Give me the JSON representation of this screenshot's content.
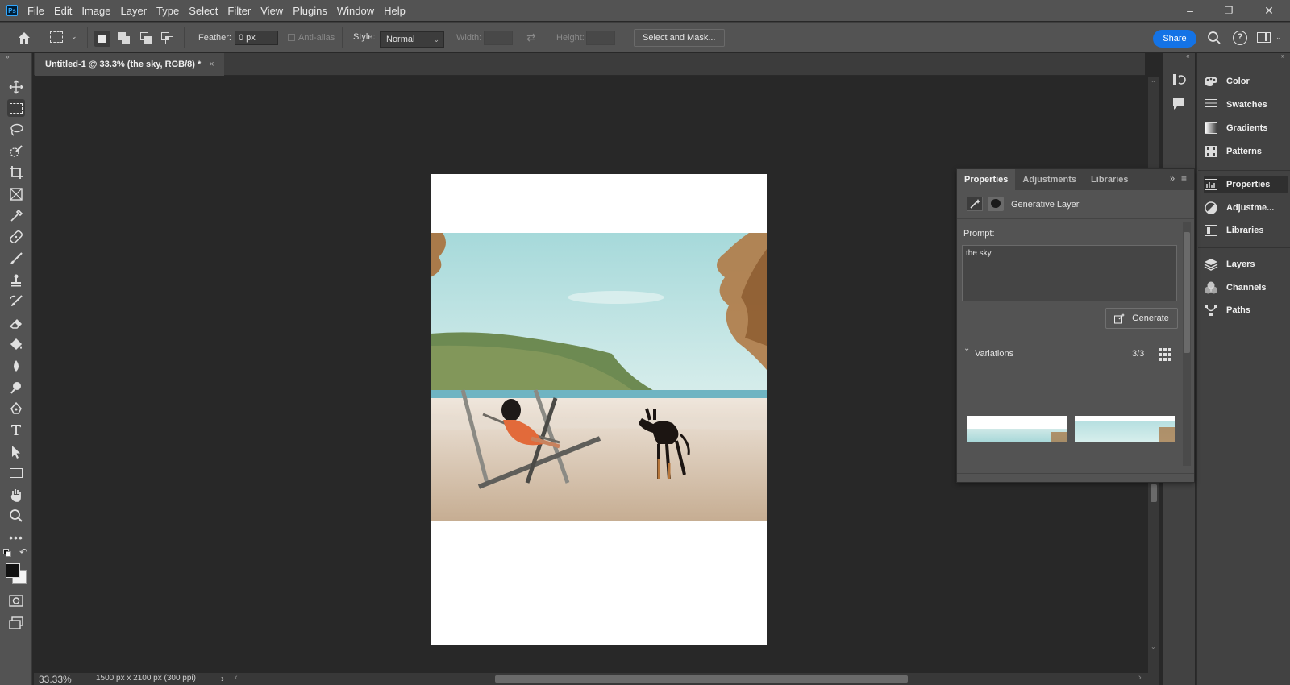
{
  "menu": {
    "logo": "Ps",
    "items": [
      "File",
      "Edit",
      "Image",
      "Layer",
      "Type",
      "Select",
      "Filter",
      "View",
      "Plugins",
      "Window",
      "Help"
    ]
  },
  "window_controls": {
    "minimize": "–",
    "restore": "❐",
    "close": "✕"
  },
  "options_bar": {
    "feather_label": "Feather:",
    "feather_value": "0 px",
    "anti_alias_label": "Anti-alias",
    "style_label": "Style:",
    "style_value": "Normal",
    "width_label": "Width:",
    "height_label": "Height:",
    "select_and_mask": "Select and Mask...",
    "share": "Share"
  },
  "document_tab": {
    "title": "Untitled-1 @ 33.3% (the sky, RGB/8) *",
    "close": "×"
  },
  "status": {
    "zoom": "33.33%",
    "doc_info": "1500 px x 2100 px (300 ppi)",
    "arrow": "›"
  },
  "dock": {
    "group1": [
      {
        "label": "Color",
        "icon": "color-icon"
      },
      {
        "label": "Swatches",
        "icon": "swatches-icon"
      },
      {
        "label": "Gradients",
        "icon": "gradients-icon"
      },
      {
        "label": "Patterns",
        "icon": "patterns-icon"
      }
    ],
    "group2": [
      {
        "label": "Properties",
        "icon": "properties-icon"
      },
      {
        "label": "Adjustme...",
        "icon": "adjustments-icon"
      },
      {
        "label": "Libraries",
        "icon": "libraries-icon"
      }
    ],
    "group3": [
      {
        "label": "Layers",
        "icon": "layers-icon"
      },
      {
        "label": "Channels",
        "icon": "channels-icon"
      },
      {
        "label": "Paths",
        "icon": "paths-icon"
      }
    ]
  },
  "properties_panel": {
    "tabs": [
      "Properties",
      "Adjustments",
      "Libraries"
    ],
    "layer_type": "Generative Layer",
    "prompt_label": "Prompt:",
    "prompt_value": "the sky",
    "generate_label": "Generate",
    "variations_label": "Variations",
    "variations_count": "3/3"
  },
  "colors": {
    "accent": "#1473e6",
    "chrome": "#535353",
    "canvas": "#282828"
  }
}
